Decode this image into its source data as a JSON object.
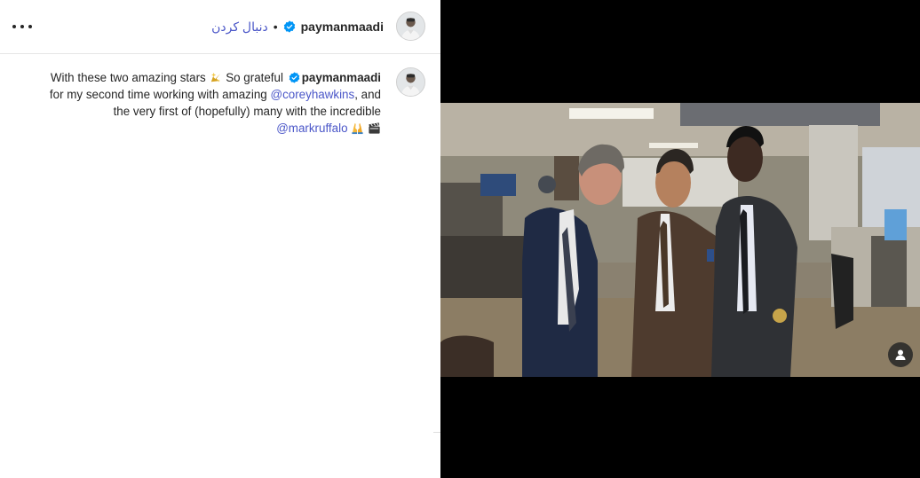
{
  "header": {
    "username": "paymanmaadi",
    "follow_label": "دنبال کردن",
    "separator": "•",
    "more_icon": "more-horizontal-icon",
    "avatar_icon": "avatar"
  },
  "caption": {
    "username": "paymanmaadi",
    "part1": "With these two amazing stars ",
    "part2": " So grateful ",
    "part3": "for my second time working with amazing ",
    "mention1": "@coreyhawkins",
    "part4": ", and",
    "part5": "the very first of (hopefully) many with the incredible",
    "mention2": "@markruffalo",
    "emoji_sparkle": "star-sparkle-icon",
    "emoji_hands": "raised-hands-icon",
    "emoji_clapper": "clapper-board-icon"
  },
  "media": {
    "tag_icon": "user-tag-icon"
  },
  "colors": {
    "link": "#4a56c8",
    "verified": "#0095f6",
    "text": "#262626"
  }
}
